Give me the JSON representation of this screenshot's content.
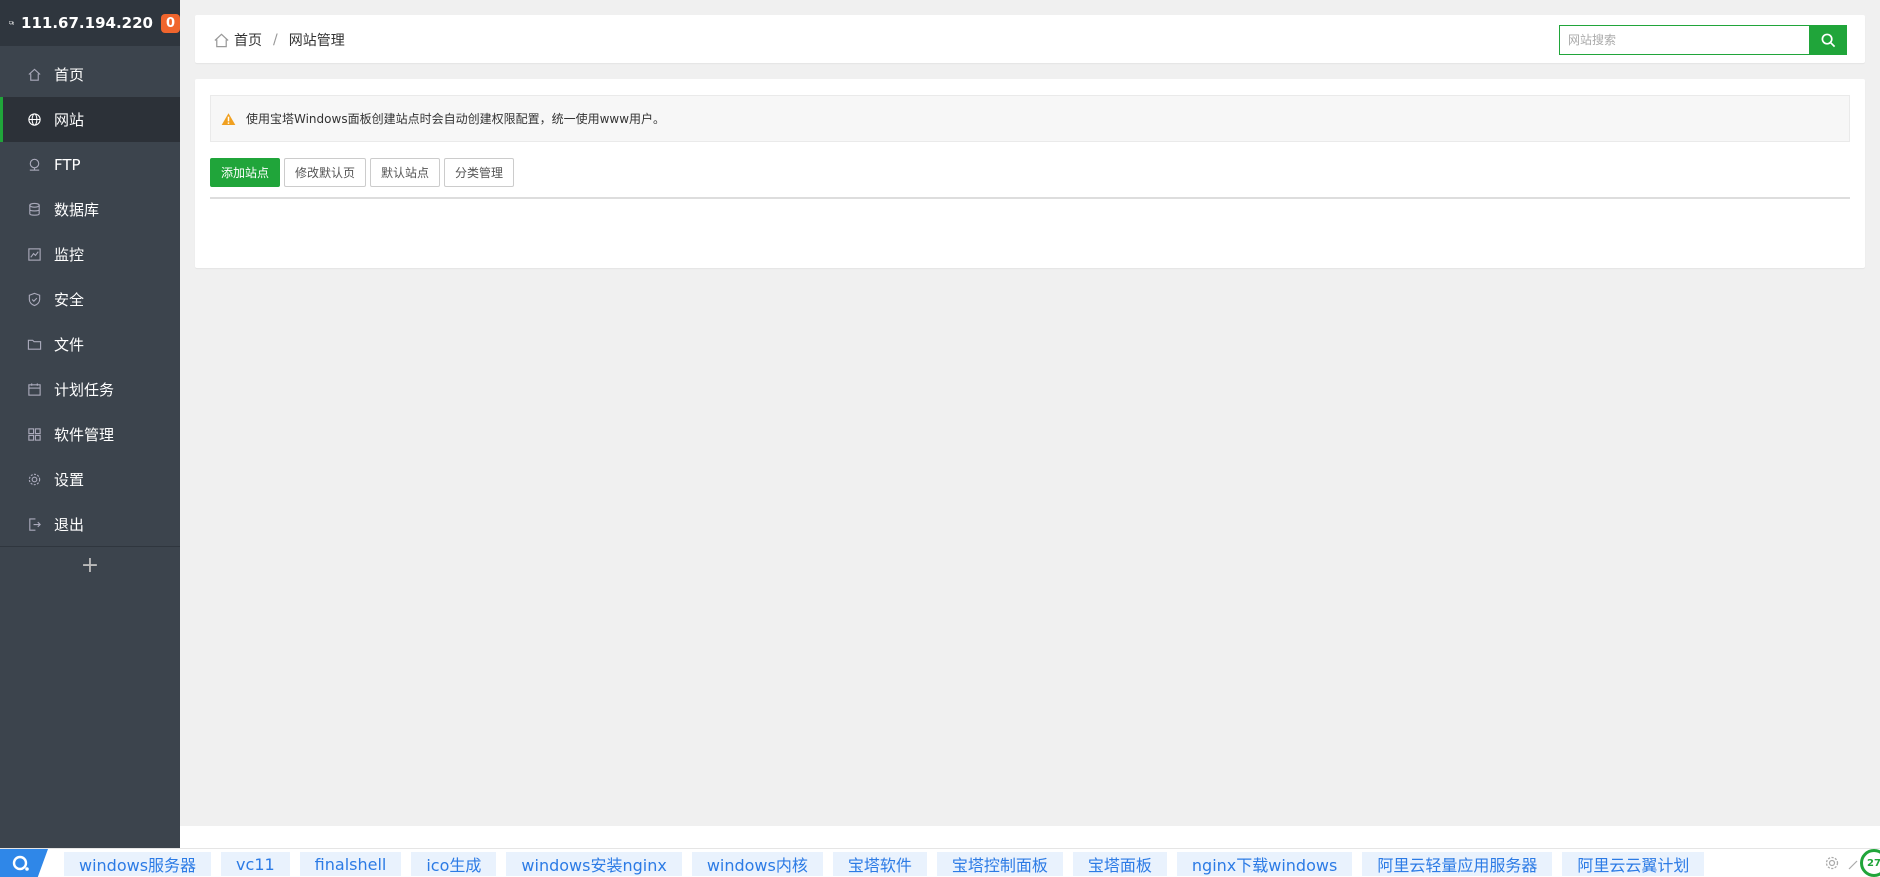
{
  "sidebar": {
    "ip": "111.67.194.220",
    "badge_count": "0",
    "items": [
      {
        "label": "首页",
        "icon": "home-icon"
      },
      {
        "label": "网站",
        "icon": "globe-icon",
        "active": true
      },
      {
        "label": "FTP",
        "icon": "ftp-icon"
      },
      {
        "label": "数据库",
        "icon": "database-icon"
      },
      {
        "label": "监控",
        "icon": "monitor-chart-icon"
      },
      {
        "label": "安全",
        "icon": "shield-icon"
      },
      {
        "label": "文件",
        "icon": "folder-icon"
      },
      {
        "label": "计划任务",
        "icon": "calendar-icon"
      },
      {
        "label": "软件管理",
        "icon": "grid-icon"
      },
      {
        "label": "设置",
        "icon": "gear-icon"
      },
      {
        "label": "退出",
        "icon": "logout-icon"
      }
    ],
    "add_label": "+"
  },
  "breadcrumb": {
    "home": "首页",
    "separator": "/",
    "current": "网站管理"
  },
  "search": {
    "placeholder": "网站搜索"
  },
  "alert": {
    "text": "使用宝塔Windows面板创建站点时会自动创建权限配置，统一使用www用户。"
  },
  "toolbar": {
    "add_site": "添加站点",
    "modify_default_page": "修改默认页",
    "default_site": "默认站点",
    "category_manage": "分类管理"
  },
  "bottom_tags": [
    "windows服务器",
    "vc11",
    "finalshell",
    "ico生成",
    "windows安装nginx",
    "windows内核",
    "宝塔软件",
    "宝塔控制面板",
    "宝塔面板",
    "nginx下载windows",
    "阿里云轻量应用服务器",
    "阿里云云翼计划"
  ],
  "corner_badge": "27",
  "colors": {
    "sidebar_bg": "#3c444d",
    "accent_green": "#20a53a",
    "badge_orange": "#f0652d",
    "tag_blue": "#2c7be5"
  }
}
